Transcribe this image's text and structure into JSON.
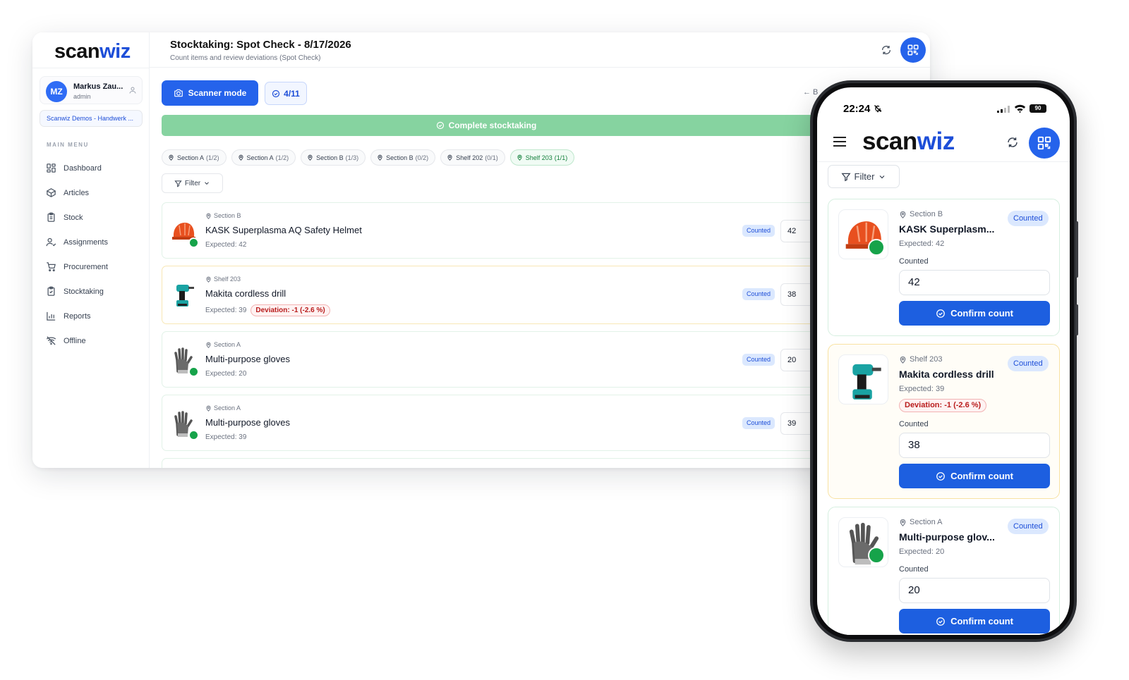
{
  "desktop": {
    "logo": {
      "prefix": "scan",
      "suffix": "wiz"
    },
    "user": {
      "initials": "MZ",
      "name": "Markus Zau...",
      "role": "admin"
    },
    "org": "Scanwiz Demos - Handwerk ...",
    "menu_heading": "MAIN MENU",
    "menu": [
      {
        "label": "Dashboard",
        "icon": "dashboard-icon"
      },
      {
        "label": "Articles",
        "icon": "box-icon"
      },
      {
        "label": "Stock",
        "icon": "clipboard-icon"
      },
      {
        "label": "Assignments",
        "icon": "user-check-icon"
      },
      {
        "label": "Procurement",
        "icon": "cart-icon"
      },
      {
        "label": "Stocktaking",
        "icon": "clipboard-check-icon"
      },
      {
        "label": "Reports",
        "icon": "bar-chart-icon"
      },
      {
        "label": "Offline",
        "icon": "wifi-off-icon"
      }
    ],
    "title": "Stocktaking: Spot Check - 8/17/2026",
    "subtitle": "Count items and review deviations (Spot Check)",
    "scanner_label": "Scanner mode",
    "progress_label": "4/11",
    "back_label": "← B",
    "complete_label": "Complete stocktaking",
    "chips": [
      {
        "label": "Section A",
        "count": "(1/2)",
        "done": false
      },
      {
        "label": "Section A",
        "count": "(1/2)",
        "done": false
      },
      {
        "label": "Section B",
        "count": "(1/3)",
        "done": false
      },
      {
        "label": "Section B",
        "count": "(0/2)",
        "done": false
      },
      {
        "label": "Shelf 202",
        "count": "(0/1)",
        "done": false
      },
      {
        "label": "Shelf 203",
        "count": "(1/1)",
        "done": true
      }
    ],
    "filter_label": "Filter",
    "rows": [
      {
        "location": "Section B",
        "name": "KASK Superplasma AQ Safety Helmet",
        "expected": "Expected: 42",
        "deviation": "",
        "status": "Counted",
        "qty": "42",
        "thumb": "helmet"
      },
      {
        "location": "Shelf 203",
        "name": "Makita cordless drill",
        "expected": "Expected: 39",
        "deviation": "Deviation: -1 (-2.6 %)",
        "status": "Counted",
        "qty": "38",
        "thumb": "drill"
      },
      {
        "location": "Section A",
        "name": "Multi-purpose gloves",
        "expected": "Expected: 20",
        "deviation": "",
        "status": "Counted",
        "qty": "20",
        "thumb": "glove"
      },
      {
        "location": "Section A",
        "name": "Multi-purpose gloves",
        "expected": "Expected: 39",
        "deviation": "",
        "status": "Counted",
        "qty": "39",
        "thumb": "glove"
      }
    ]
  },
  "mobile": {
    "time": "22:24",
    "battery": "90",
    "logo": {
      "prefix": "scan",
      "suffix": "wiz"
    },
    "filter_label": "Filter",
    "counted_label": "Counted",
    "confirm_label": "Confirm count",
    "cards": [
      {
        "location": "Section B",
        "name": "KASK Superplasm...",
        "expected": "Expected: 42",
        "deviation": "",
        "status": "Counted",
        "value": "42",
        "thumb": "helmet"
      },
      {
        "location": "Shelf 203",
        "name": "Makita cordless drill",
        "expected": "Expected: 39",
        "deviation": "Deviation: -1 (-2.6 %)",
        "status": "Counted",
        "value": "38",
        "thumb": "drill"
      },
      {
        "location": "Section A",
        "name": "Multi-purpose glov...",
        "expected": "Expected: 20",
        "deviation": "",
        "status": "Counted",
        "value": "20",
        "thumb": "glove"
      }
    ]
  },
  "colors": {
    "primary": "#2563eb",
    "success": "#16a34a",
    "complete_bar": "#86d3a0",
    "deviation": "#b91c1c"
  }
}
